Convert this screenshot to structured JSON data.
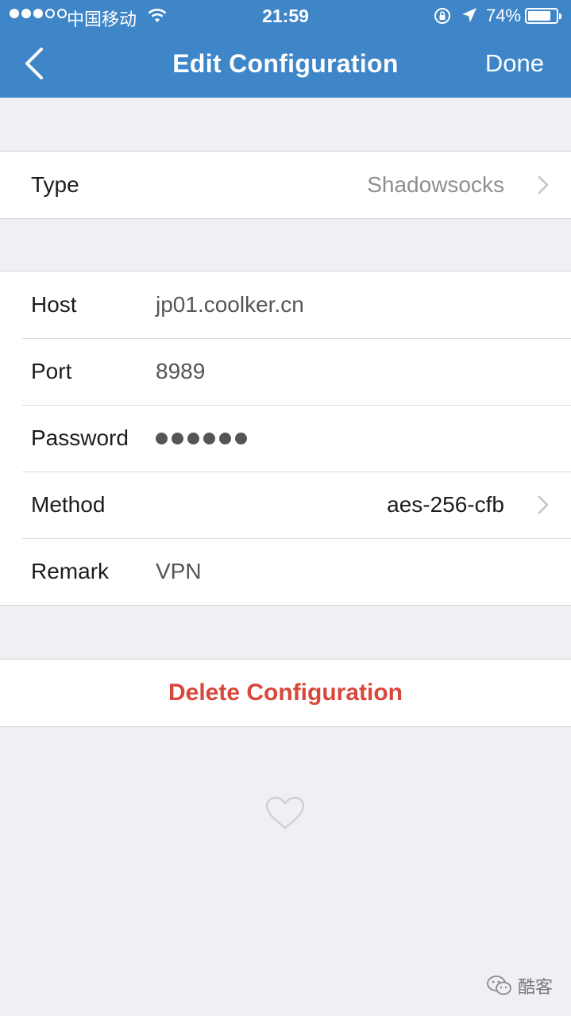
{
  "status_bar": {
    "carrier": "中国移动",
    "time": "21:59",
    "battery_percent": "74%",
    "battery_level": 0.74,
    "signal_bars_filled": 3,
    "signal_bars_total": 5
  },
  "nav": {
    "back_icon": "chevron-left-icon",
    "title": "Edit Configuration",
    "done_label": "Done"
  },
  "type_section": {
    "label": "Type",
    "value": "Shadowsocks"
  },
  "fields": {
    "host": {
      "label": "Host",
      "value": "jp01.coolker.cn"
    },
    "port": {
      "label": "Port",
      "value": "8989"
    },
    "password": {
      "label": "Password",
      "masked_length": 6
    },
    "method": {
      "label": "Method",
      "value": "aes-256-cfb"
    },
    "remark": {
      "label": "Remark",
      "value": "VPN"
    }
  },
  "actions": {
    "delete_label": "Delete Configuration"
  },
  "watermark": {
    "text": "酷客"
  },
  "colors": {
    "nav_background": "#3f86c8",
    "page_background": "#efeff4",
    "delete_red": "#d9463a"
  }
}
